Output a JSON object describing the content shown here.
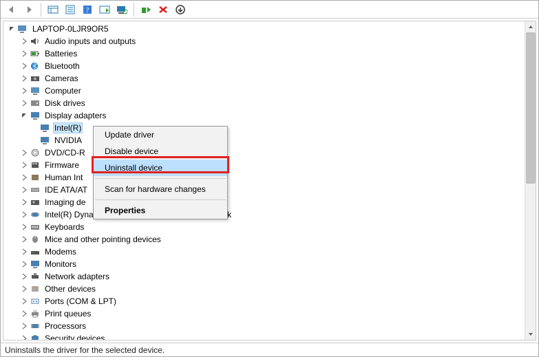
{
  "root": {
    "label": "LAPTOP-0LJR9OR5"
  },
  "categories": {
    "audio": "Audio inputs and outputs",
    "batteries": "Batteries",
    "bluetooth": "Bluetooth",
    "cameras": "Cameras",
    "computer": "Computer",
    "disk": "Disk drives",
    "display": "Display adapters",
    "dvd": "DVD/CD-R",
    "firmware": "Firmware",
    "hid": "Human Int",
    "ide": "IDE ATA/AT",
    "imaging": "Imaging de",
    "dptf": "Intel(R) Dynamic Platform and Thermal Framework",
    "keyboards": "Keyboards",
    "mice": "Mice and other pointing devices",
    "modems": "Modems",
    "monitors": "Monitors",
    "network": "Network adapters",
    "other": "Other devices",
    "ports": "Ports (COM & LPT)",
    "print": "Print queues",
    "processors": "Processors",
    "security": "Security devices"
  },
  "display_children": {
    "intel": "Intel(R)",
    "nvidia": "NVIDIA"
  },
  "context_menu": {
    "update": "Update driver",
    "disable": "Disable device",
    "uninstall": "Uninstall device",
    "scan": "Scan for hardware changes",
    "properties": "Properties"
  },
  "status": "Uninstalls the driver for the selected device."
}
